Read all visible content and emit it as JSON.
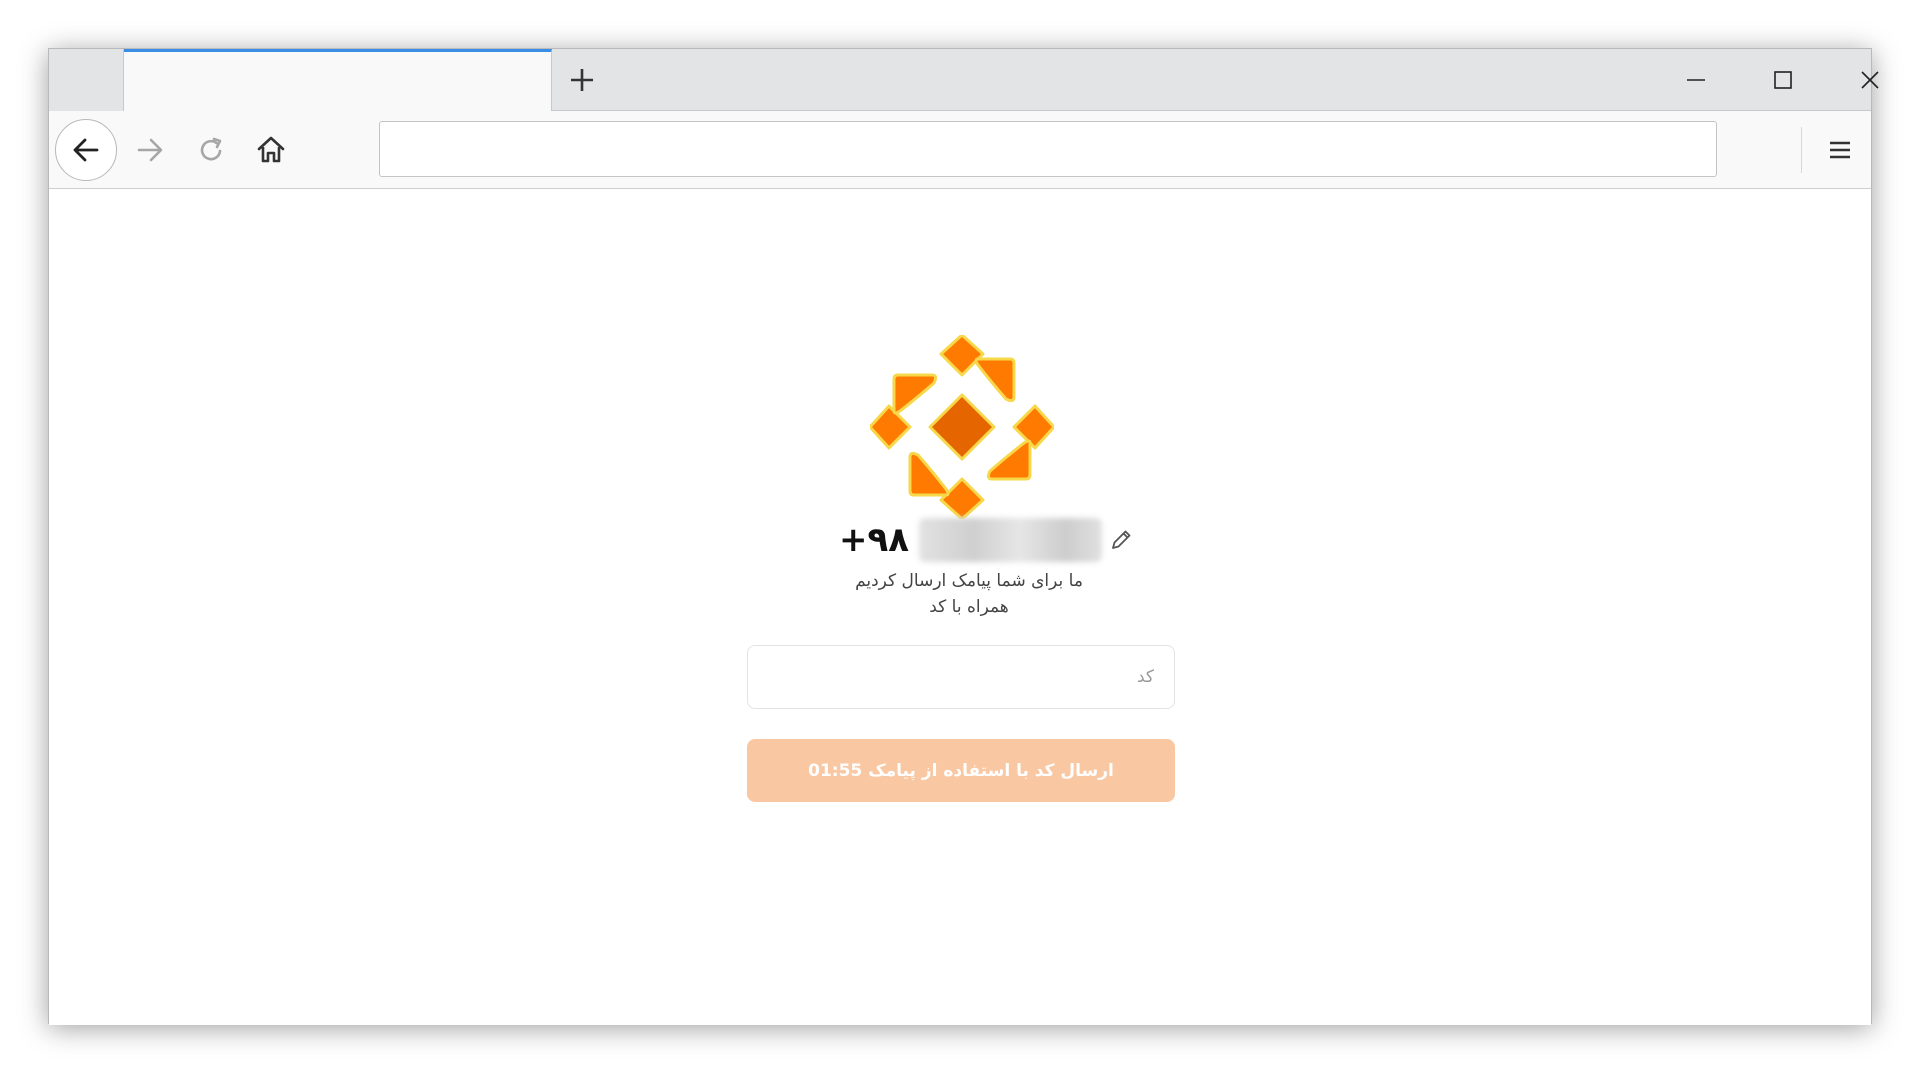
{
  "browser": {
    "new_tab_icon": "plus-icon",
    "window_controls": [
      "minimize-icon",
      "maximize-icon",
      "close-icon"
    ],
    "nav_icons": [
      "back-arrow-icon",
      "forward-arrow-icon",
      "reload-icon",
      "home-icon"
    ],
    "url_value": "",
    "menu_icon": "hamburger-menu-icon",
    "accent_color": "#3a8ee6"
  },
  "login": {
    "logo_icon": "orange-flower-logo-icon",
    "phone_prefix": "+۹۸",
    "edit_icon": "pencil-icon",
    "message_line1": "ما برای شما پیامک ارسال کردیم",
    "message_line2": "همراه با کد",
    "code_placeholder": "کد",
    "send_button_label": "ارسال کد با استفاده از پیامک",
    "send_button_timer": "01:55",
    "button_color": "#f9c8a3",
    "logo_colors": {
      "primary": "#ff7a00",
      "dark": "#e56500",
      "outline": "#f7d84a"
    }
  }
}
